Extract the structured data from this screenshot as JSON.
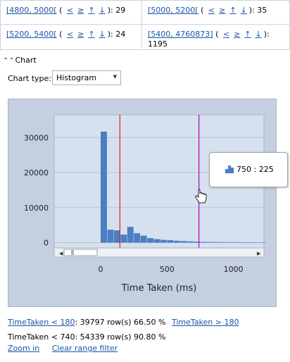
{
  "range_table": {
    "cells": [
      {
        "range": "[4800, 5000[",
        "nav": [
          "<",
          "≥",
          "↑",
          "↓"
        ],
        "count": "29"
      },
      {
        "range": "[5000, 5200[",
        "nav": [
          "<",
          "≥",
          "↑",
          "↓"
        ],
        "count": "35"
      },
      {
        "range": "[5200, 5400[",
        "nav": [
          "<",
          "≥",
          "↑",
          "↓"
        ],
        "count": "24"
      },
      {
        "range": "[5400, 4760873]",
        "nav": [
          "<",
          "≥",
          "↑",
          "↓"
        ],
        "count": "1195"
      }
    ]
  },
  "chart_section": {
    "title": "Chart",
    "collapse_icon": "double-chevron-up-icon",
    "chart_type_label": "Chart type:",
    "chart_type_value": "Histogram"
  },
  "chart_data": {
    "type": "bar",
    "subtype": "histogram",
    "xlabel": "Time Taken  (ms)",
    "ylabel": "",
    "xlim": [
      -350,
      1230
    ],
    "ylim": [
      -1500,
      36500
    ],
    "x_ticks": [
      0,
      500,
      1000
    ],
    "y_ticks": [
      0,
      10000,
      20000,
      30000
    ],
    "x_tick_labels": [
      "0",
      "500",
      "1000"
    ],
    "y_tick_labels": [
      "0",
      "10000",
      "20000",
      "30000"
    ],
    "bin_width": 50,
    "bins": [
      {
        "x0": 0,
        "value": 31700
      },
      {
        "x0": 50,
        "value": 3700
      },
      {
        "x0": 100,
        "value": 3500
      },
      {
        "x0": 150,
        "value": 2300
      },
      {
        "x0": 200,
        "value": 4500
      },
      {
        "x0": 250,
        "value": 2700
      },
      {
        "x0": 300,
        "value": 2000
      },
      {
        "x0": 350,
        "value": 1300
      },
      {
        "x0": 400,
        "value": 1000
      },
      {
        "x0": 450,
        "value": 800
      },
      {
        "x0": 500,
        "value": 700
      },
      {
        "x0": 550,
        "value": 550
      },
      {
        "x0": 600,
        "value": 450
      },
      {
        "x0": 650,
        "value": 380
      },
      {
        "x0": 700,
        "value": 300
      },
      {
        "x0": 750,
        "value": 225
      },
      {
        "x0": 800,
        "value": 200
      },
      {
        "x0": 850,
        "value": 180
      },
      {
        "x0": 900,
        "value": 160
      },
      {
        "x0": 950,
        "value": 150
      },
      {
        "x0": 1000,
        "value": 140
      },
      {
        "x0": 1050,
        "value": 130
      },
      {
        "x0": 1100,
        "value": 120
      },
      {
        "x0": 1150,
        "value": 110
      },
      {
        "x0": 1200,
        "value": 100
      }
    ],
    "markers": [
      {
        "x": 145,
        "color": "#d92020"
      },
      {
        "x": 740,
        "color": "#b400c8"
      }
    ],
    "bar_color": "#4a7fc1",
    "grid": true,
    "tooltip": "750 : 225"
  },
  "stats": {
    "line1_link": "TimeTaken < 180",
    "line1_text": ": 39797 row(s) 66.50 %",
    "line1_link2": "TimeTaken > 180",
    "line2_text": "TimeTaken < 740: 54339 row(s) 90.80 %",
    "zoom_in": "Zoom in",
    "clear_filter": "Clear range filter"
  }
}
